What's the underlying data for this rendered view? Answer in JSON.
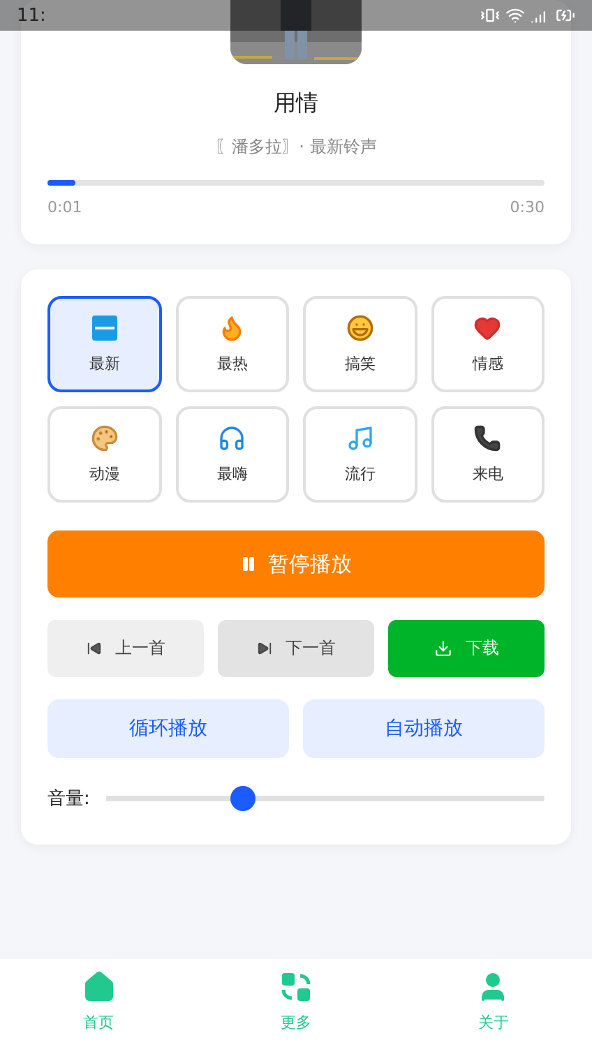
{
  "status_bar": {
    "time": "11:"
  },
  "now_playing": {
    "title": "用情",
    "subtitle": "〖潘多拉〗· 最新铃声",
    "progress": {
      "level": 0.055,
      "elapsed": "0:01",
      "total": "0:30"
    }
  },
  "categories": [
    {
      "label": "最新",
      "kind": "new",
      "selected": true
    },
    {
      "label": "最热",
      "kind": "fire",
      "selected": false
    },
    {
      "label": "搞笑",
      "kind": "laugh",
      "selected": false
    },
    {
      "label": "情感",
      "kind": "heart",
      "selected": false
    },
    {
      "label": "动漫",
      "kind": "palette",
      "selected": false
    },
    {
      "label": "最嗨",
      "kind": "headphones",
      "selected": false
    },
    {
      "label": "流行",
      "kind": "music",
      "selected": false
    },
    {
      "label": "来电",
      "kind": "phone",
      "selected": false
    }
  ],
  "play_button": {
    "label": "暂停播放"
  },
  "transport": [
    {
      "label": "上一首",
      "kind": "prev"
    },
    {
      "label": "下一首",
      "kind": "next"
    },
    {
      "label": "下载",
      "kind": "download"
    }
  ],
  "modes": [
    {
      "label": "循环播放"
    },
    {
      "label": "自动播放"
    }
  ],
  "volume": {
    "label": "音量:",
    "level": 0.31
  },
  "bottom_nav": [
    {
      "label": "首页",
      "kind": "home"
    },
    {
      "label": "更多",
      "kind": "more"
    },
    {
      "label": "关于",
      "kind": "about"
    }
  ]
}
